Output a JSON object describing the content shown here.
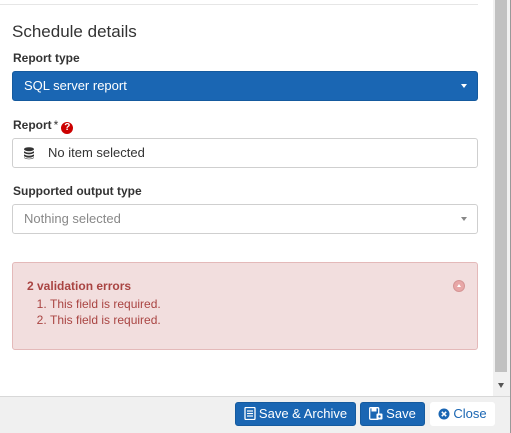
{
  "section": {
    "title": "Schedule details"
  },
  "fields": {
    "report_type": {
      "label": "Report type",
      "value": "SQL server report"
    },
    "report": {
      "label": "Report",
      "required_mark": "*",
      "value": "No item selected"
    },
    "output_type": {
      "label": "Supported output type",
      "placeholder": "Nothing selected"
    }
  },
  "validation": {
    "title": "2 validation errors",
    "errors": [
      "This field is required.",
      "This field is required."
    ]
  },
  "buttons": {
    "save_archive": "Save & Archive",
    "save": "Save",
    "close": "Close"
  },
  "colors": {
    "primary": "#1a66b3",
    "error_bg": "#f2dede",
    "error_text": "#a94442"
  }
}
